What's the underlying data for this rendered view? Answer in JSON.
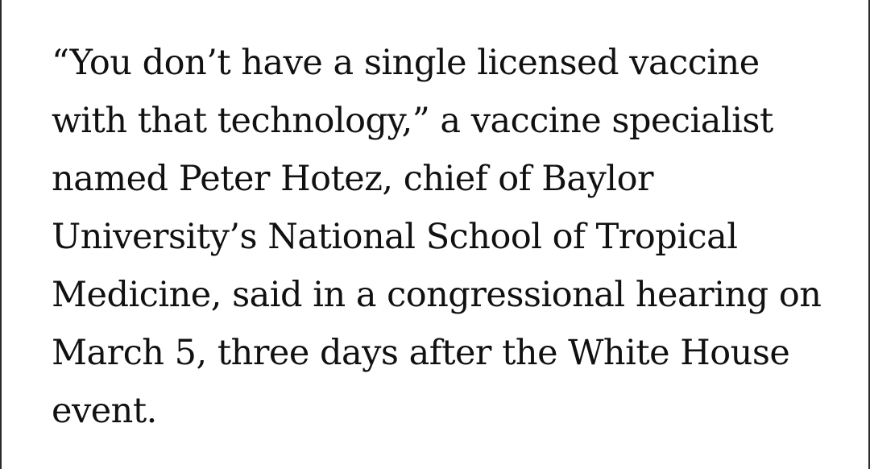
{
  "article": {
    "quote_lines": [
      "“You don’t have a single licensed vaccine",
      "with that technology,” a vaccine specialist",
      "named Peter Hotez, chief of Baylor",
      "University’s National School of Tropical",
      "Medicine, said in a congressional hearing on",
      "March 5, three days after the White House",
      "event."
    ]
  }
}
